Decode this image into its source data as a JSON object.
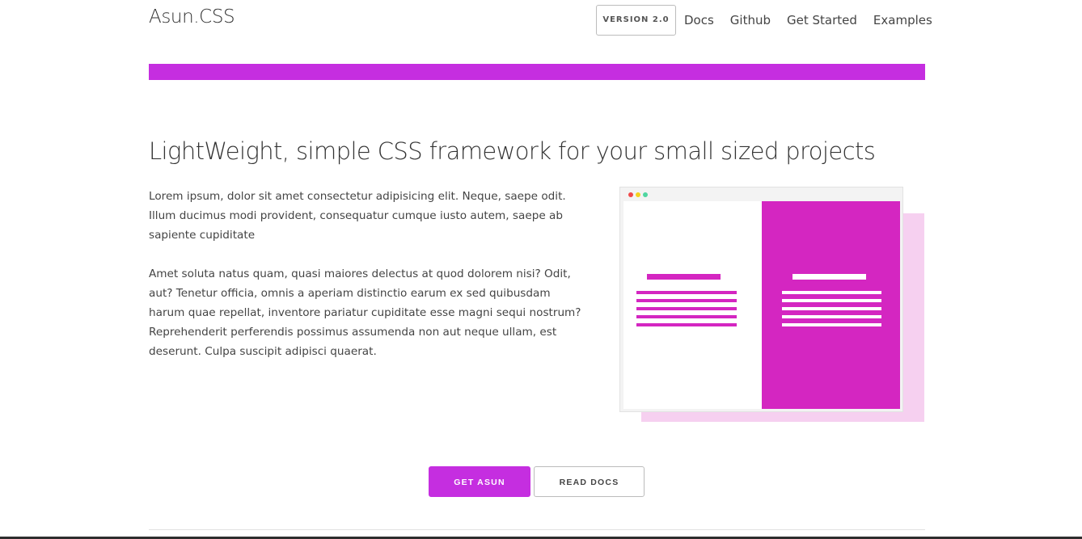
{
  "header": {
    "brand": "Asun.CSS",
    "version_label": "VERSION 2.0",
    "nav": [
      {
        "label": "Docs"
      },
      {
        "label": "Github"
      },
      {
        "label": "Get Started"
      },
      {
        "label": "Examples"
      }
    ]
  },
  "hero": {
    "title": "LightWeight, simple CSS framework for your small sized projects",
    "paragraphs": [
      "Lorem ipsum, dolor sit amet consectetur adipisicing elit. Neque, saepe odit. Illum ducimus modi provident, consequatur cumque iusto autem, saepe ab sapiente cupiditate",
      "Amet soluta natus quam, quasi maiores delectus at quod dolorem nisi? Odit, aut? Tenetur officia, omnis a aperiam distinctio earum ex sed quibusdam harum quae repellat, inventore pariatur cupiditate esse magni sequi nostrum? Reprehenderit perferendis possimus assumenda non aut neque ullam, est deserunt. Culpa suscipit adipisci quaerat."
    ]
  },
  "illustration": {
    "dot_colors": [
      "#f04848",
      "#f5d21e",
      "#4fd6a0"
    ],
    "accent_color": "#d426c1",
    "shadow_color": "#f6d0f0"
  },
  "actions": {
    "primary_label": "GET ASUN",
    "secondary_label": "READ DOCS"
  },
  "colors": {
    "brand": "#c52ee0"
  }
}
